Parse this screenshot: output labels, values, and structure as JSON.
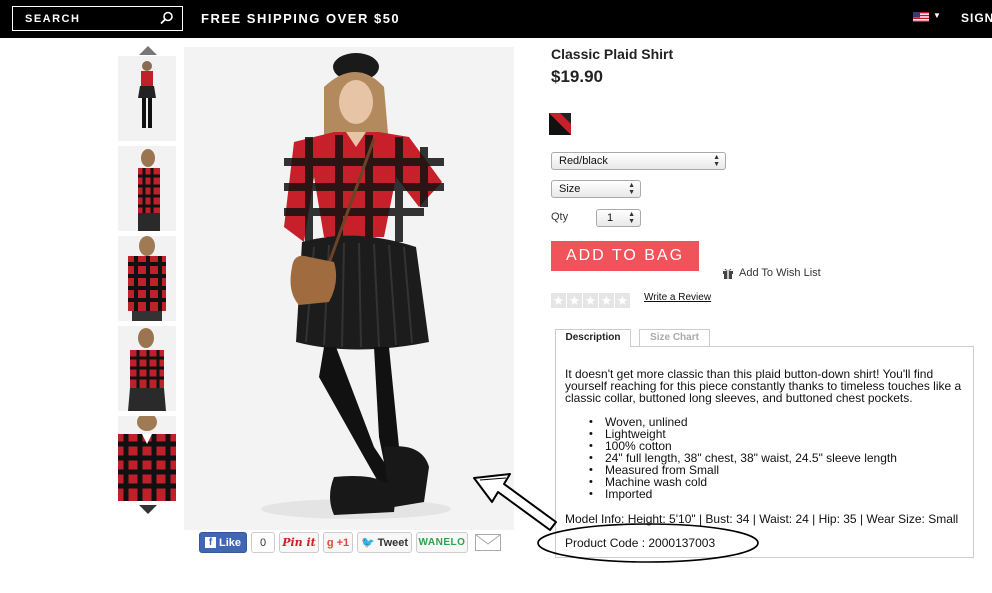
{
  "header": {
    "search_label": "SEARCH",
    "promo": "FREE SHIPPING OVER $50",
    "signin_label": "SIGN"
  },
  "product": {
    "title": "Classic Plaid Shirt",
    "price": "$19.90",
    "color_select": "Red/black",
    "size_select": "Size",
    "qty_label": "Qty",
    "qty_value": "1",
    "add_to_bag": "ADD TO BAG",
    "wish_list": "Add To Wish List",
    "write_review": "Write a Review",
    "rating": 0
  },
  "tabs": {
    "description": "Description",
    "size_chart": "Size Chart"
  },
  "description": {
    "text": "It doesn't get more classic than this plaid button-down shirt! You'll find yourself reaching for this piece constantly thanks to timeless touches like a classic collar, buttoned long sleeves, and buttoned chest pockets.",
    "bullets": [
      "Woven, unlined",
      "Lightweight",
      "100% cotton",
      "24\" full length, 38\" chest, 38\" waist, 24.5\" sleeve length",
      "Measured from Small",
      "Machine wash cold",
      "Imported"
    ],
    "model_info": "Model Info: Height: 5'10\" | Bust: 34 | Waist: 24 | Hip: 35 | Wear Size: Small",
    "product_code": "Product Code : 2000137003"
  },
  "social": {
    "fb_like": "Like",
    "fb_count": "0",
    "pinterest": "Pin it",
    "gplus": "+1",
    "tweet": "Tweet",
    "wanelo": "WANELO"
  },
  "colors": {
    "topbar": "#000000",
    "add_to_bag": "#f0535a",
    "shirt_red": "#d0202a"
  }
}
